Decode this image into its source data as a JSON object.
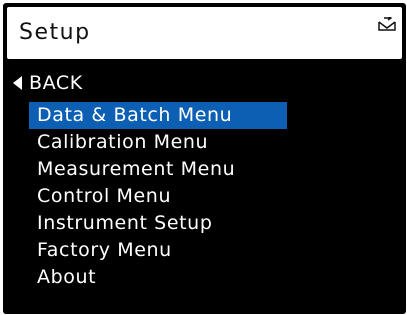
{
  "header": {
    "title": "Setup",
    "status_icon": "envelope-arrow-icon"
  },
  "back": {
    "label": "BACK",
    "icon": "left-triangle-icon"
  },
  "menu": {
    "selected_index": 0,
    "items": [
      {
        "label": "Data & Batch Menu"
      },
      {
        "label": "Calibration Menu"
      },
      {
        "label": "Measurement Menu"
      },
      {
        "label": "Control Menu"
      },
      {
        "label": "Instrument Setup"
      },
      {
        "label": "Factory Menu"
      },
      {
        "label": "About"
      }
    ]
  },
  "colors": {
    "background": "#000000",
    "header_background": "#ffffff",
    "selection": "#0d5fb4",
    "text": "#ffffff"
  }
}
